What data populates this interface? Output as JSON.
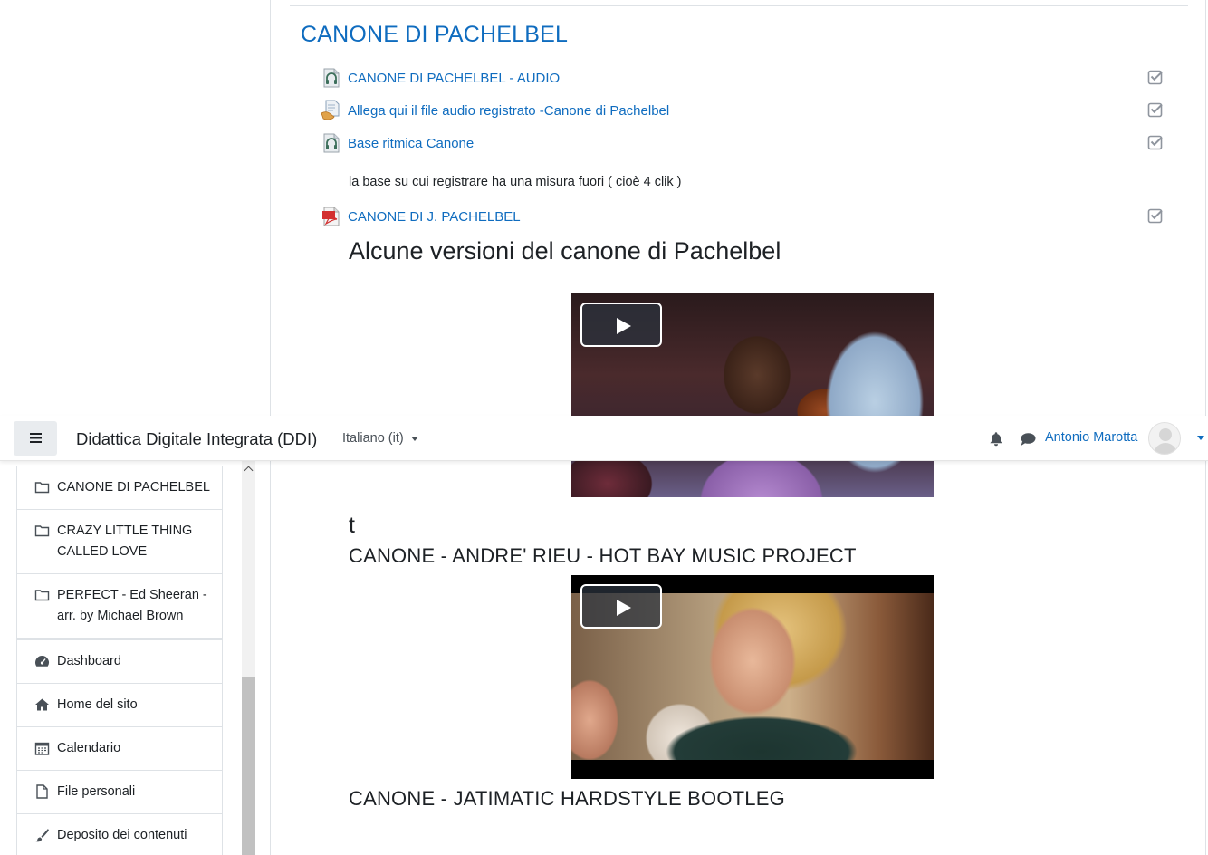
{
  "section": {
    "title": "CANONE DI PACHELBEL"
  },
  "activities": [
    {
      "label": "CANONE DI PACHELBEL - AUDIO",
      "icon": "audio-file-icon"
    },
    {
      "label": "Allega qui il file audio registrato -Canone di Pachelbel",
      "icon": "assignment-icon"
    },
    {
      "label": "Base ritmica Canone",
      "icon": "audio-file-icon"
    },
    {
      "label": "CANONE DI J. PACHELBEL",
      "icon": "pdf-file-icon"
    }
  ],
  "description": "la base su cui registrare ha una misura fuori ( cioè 4 clik )",
  "content": {
    "heading_versions": "Alcune versioni del canone di Pachelbel",
    "stray_text": "t",
    "heading_video2": "CANONE - ANDRE' RIEU - HOT BAY MUSIC PROJECT",
    "heading_video3": "CANONE  - JATIMATIC HARDSTYLE BOOTLEG"
  },
  "navbar": {
    "site_name": "Didattica Digitale Integrata (DDI)",
    "language": "Italiano (it)",
    "user_name": "Antonio Marotta"
  },
  "drawer": {
    "sections": [
      {
        "label": "CANONE DI PACHELBEL",
        "icon": "folder-icon"
      },
      {
        "label": "CRAZY LITTLE THING CALLED LOVE",
        "icon": "folder-icon"
      },
      {
        "label": "PERFECT - Ed Sheeran - arr. by Michael Brown",
        "icon": "folder-icon"
      }
    ],
    "nav": [
      {
        "label": "Dashboard",
        "icon": "dashboard-icon"
      },
      {
        "label": "Home del sito",
        "icon": "home-icon"
      },
      {
        "label": "Calendario",
        "icon": "calendar-icon"
      },
      {
        "label": "File personali",
        "icon": "file-icon"
      },
      {
        "label": "Deposito dei contenuti",
        "icon": "brush-icon"
      }
    ]
  },
  "colors": {
    "link": "#0f6cbf",
    "text": "#1d2125",
    "border": "#dee2e6"
  }
}
